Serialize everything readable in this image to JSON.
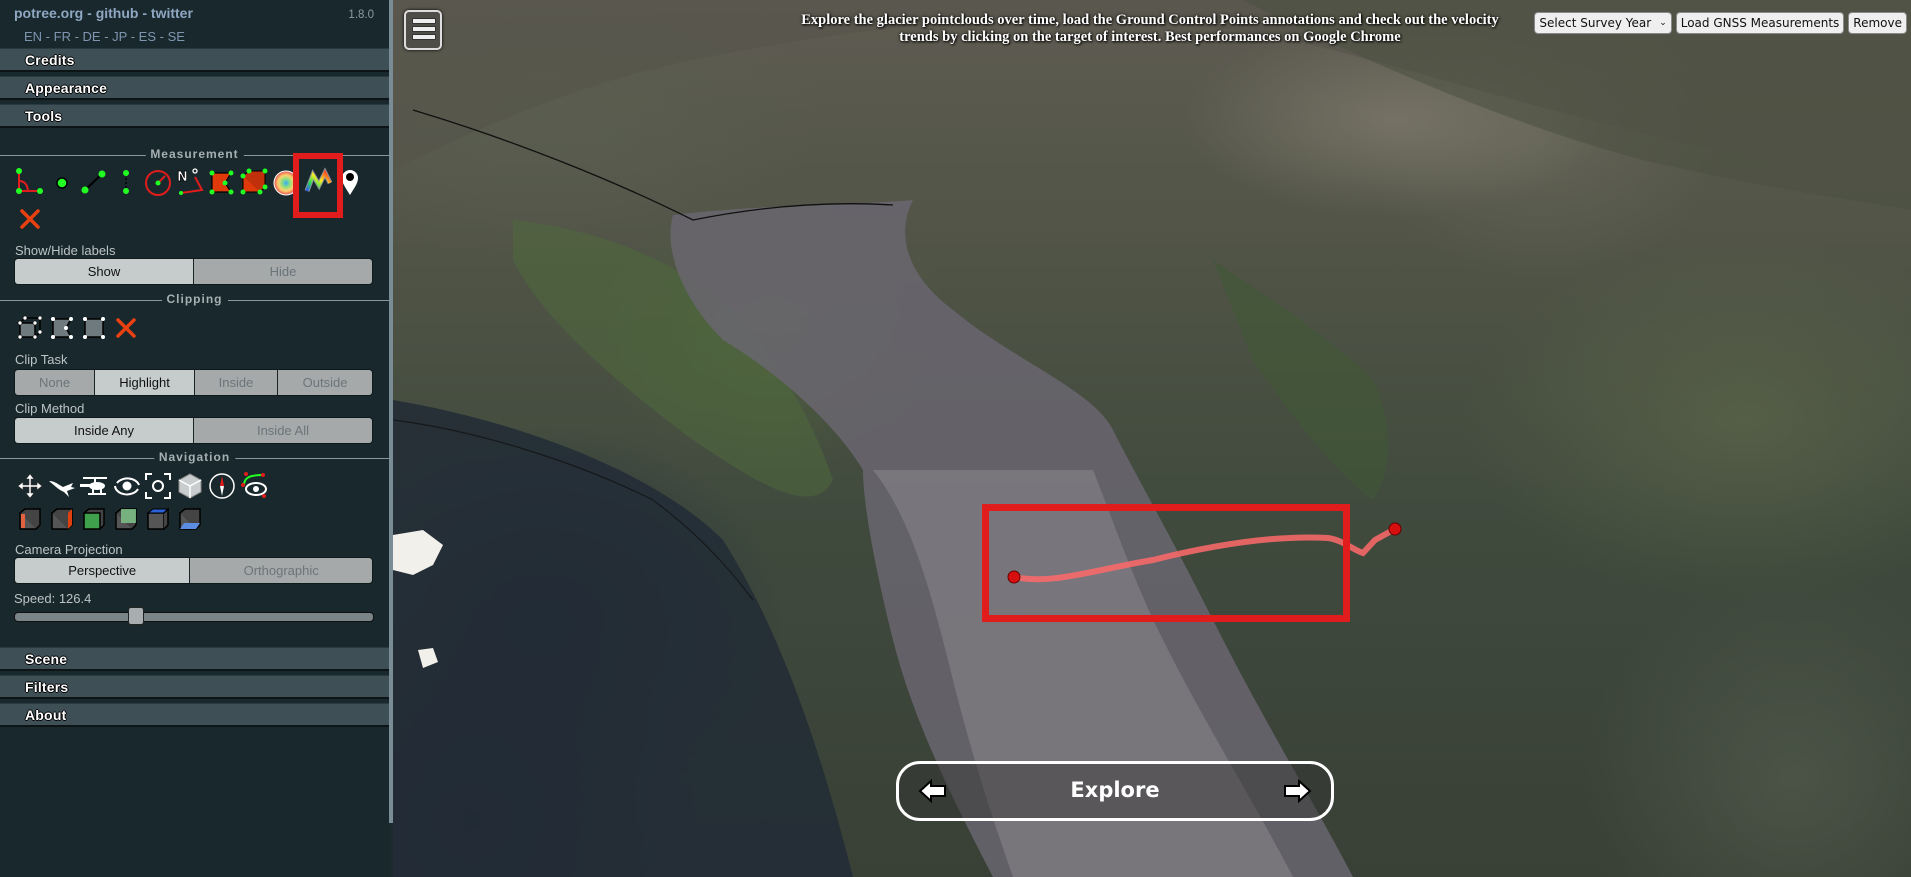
{
  "header": {
    "links": [
      "potree.org",
      "github",
      "twitter"
    ],
    "separator": " - ",
    "version": "1.8.0",
    "languages": [
      "EN",
      "FR",
      "DE",
      "JP",
      "ES",
      "SE"
    ]
  },
  "accordion_top": [
    {
      "label": "Credits"
    },
    {
      "label": "Appearance"
    },
    {
      "label": "Tools"
    }
  ],
  "accordion_bottom": [
    {
      "label": "Scene"
    },
    {
      "label": "Filters"
    },
    {
      "label": "About"
    }
  ],
  "tools": {
    "measurement": {
      "title": "Measurement",
      "icons": [
        "angle-icon",
        "point-icon",
        "distance-icon",
        "height-icon",
        "circle-icon",
        "azimuth-icon",
        "area-icon",
        "volume-icon",
        "sphere-volume-icon",
        "height-profile-icon",
        "annotation-icon",
        "remove-measurements-icon"
      ],
      "highlighted_tool": "height-profile-icon",
      "labels_caption": "Show/Hide labels",
      "labels_options": [
        "Show",
        "Hide"
      ],
      "labels_selected": "Show"
    },
    "clipping": {
      "title": "Clipping",
      "icons": [
        "clip-volume-icon",
        "clip-polygon-icon",
        "clip-screen-box-icon",
        "remove-clipping-icon"
      ],
      "task_caption": "Clip Task",
      "task_options": [
        "None",
        "Highlight",
        "Inside",
        "Outside"
      ],
      "task_selected": "Highlight",
      "method_caption": "Clip Method",
      "method_options": [
        "Inside Any",
        "Inside All"
      ],
      "method_selected": "Inside Any"
    },
    "navigation": {
      "title": "Navigation",
      "icons": [
        "earth-controls-icon",
        "fps-controls-icon",
        "helicopter-controls-icon",
        "orbit-controls-icon",
        "focus-icon",
        "navigation-cube-icon",
        "compass-icon",
        "camera-animation-icon"
      ],
      "view_icons": [
        "left-view-icon",
        "right-view-icon",
        "front-view-icon",
        "back-view-icon",
        "top-view-icon",
        "bottom-view-icon"
      ],
      "projection_caption": "Camera Projection",
      "projection_options": [
        "Perspective",
        "Orthographic"
      ],
      "projection_selected": "Perspective",
      "speed_label": "Speed: 126.4",
      "speed_value": 126.4,
      "speed_slider_fraction": 0.33
    }
  },
  "viewer": {
    "info_text": "Explore the glacier pointclouds over time, load the Ground Control Points annotations and check out the velocity trends by clicking on the target of interest. Best performances on Google Chrome",
    "survey_select": {
      "selected": "Select Survey Year"
    },
    "load_gnss_label": "Load GNSS Measurements",
    "remove_label": "Remove",
    "explore_label": "Explore",
    "accent_color": "#e01c1c",
    "profile_line_color": "#ff6a6a"
  }
}
